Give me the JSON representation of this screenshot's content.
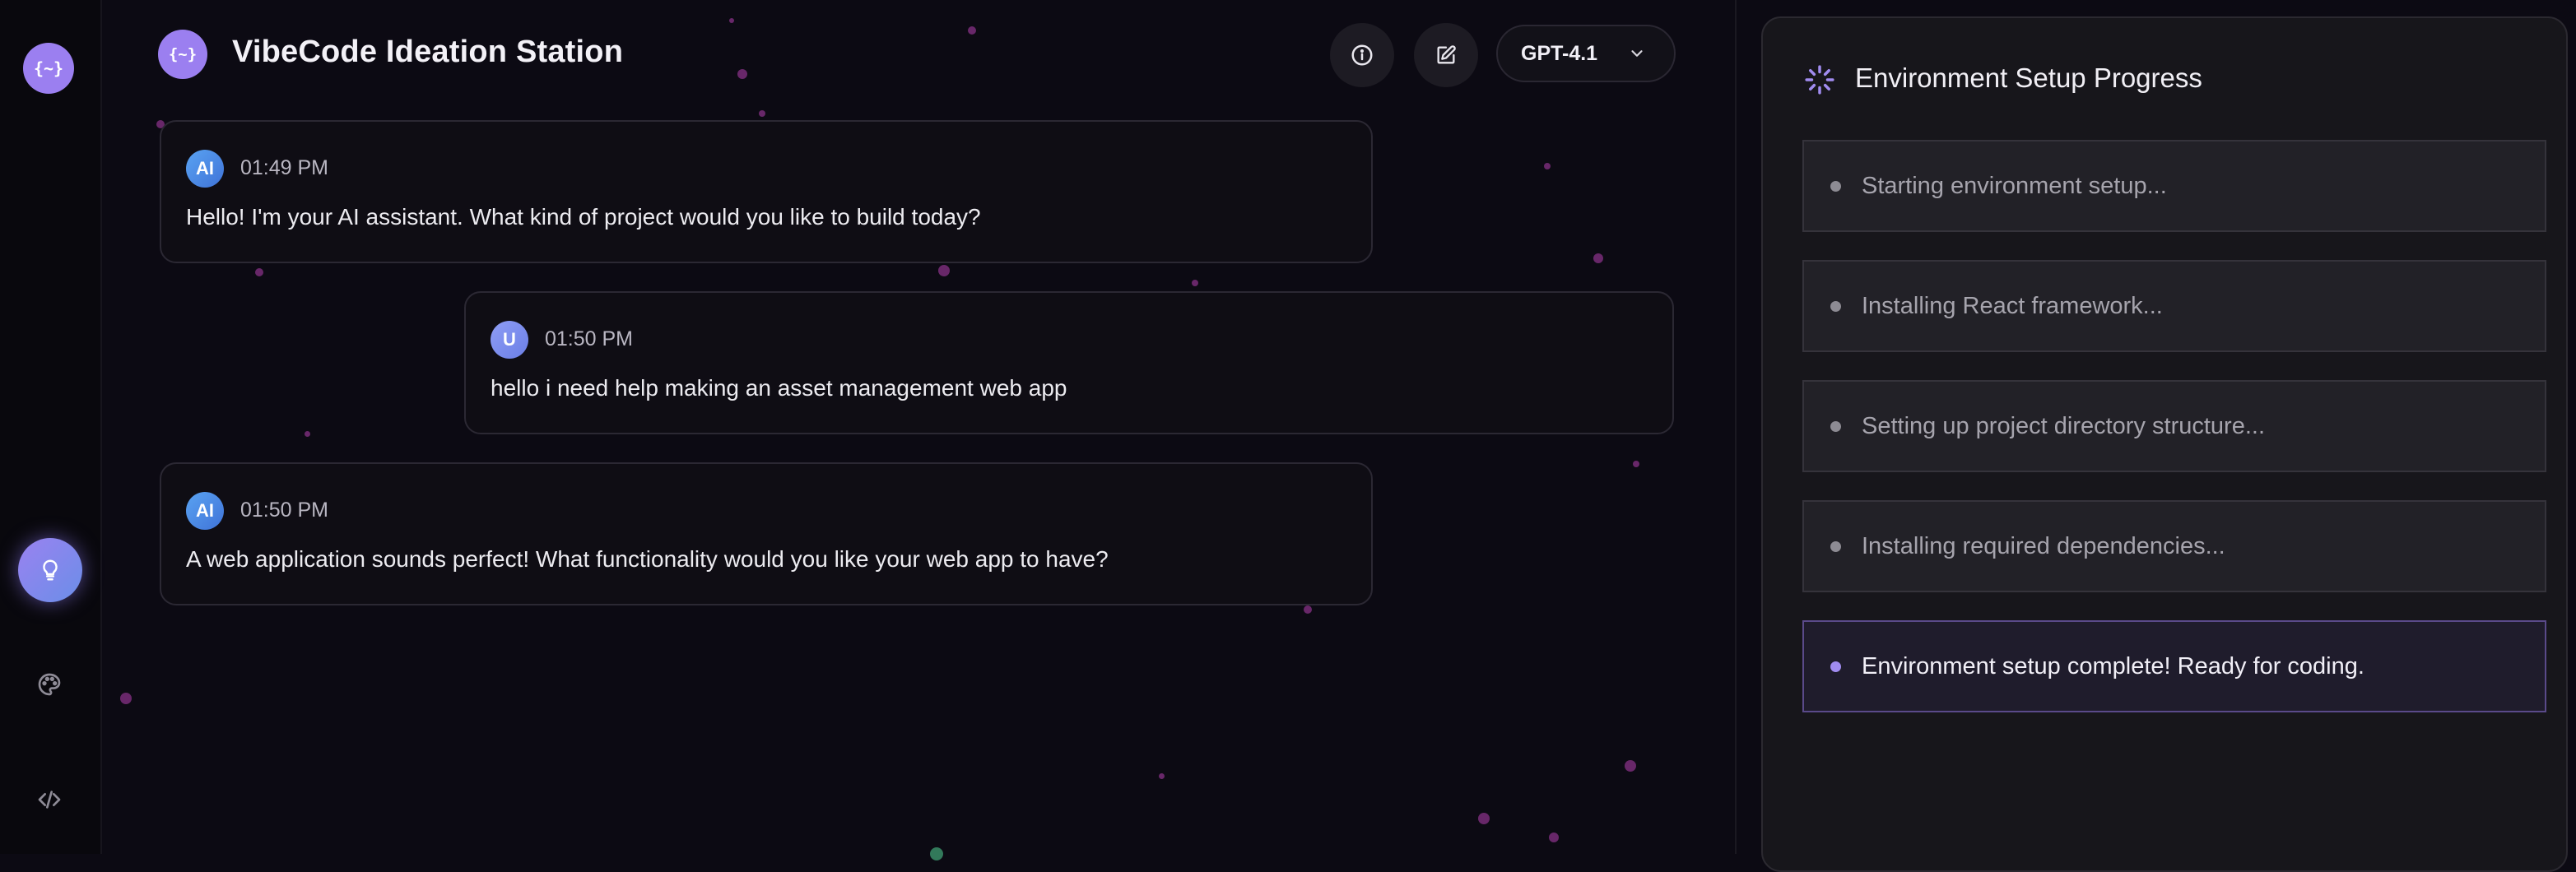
{
  "app": {
    "logo_text": "{~}",
    "title": "VibeCode Ideation Station"
  },
  "header": {
    "model_selected": "GPT-4.1"
  },
  "messages": [
    {
      "author": "ai",
      "avatar": "AI",
      "time": "01:49 PM",
      "text": "Hello! I'm your AI assistant. What kind of project would you like to build today?"
    },
    {
      "author": "user",
      "avatar": "U",
      "time": "01:50 PM",
      "text": "hello i need help making an asset management web app"
    },
    {
      "author": "ai",
      "avatar": "AI",
      "time": "01:50 PM",
      "text": "A web application sounds perfect! What functionality would you like your web app to have?"
    }
  ],
  "sidebar": {
    "icons": [
      "logo",
      "lightbulb-icon",
      "palette-icon",
      "code-icon"
    ]
  },
  "setup_panel": {
    "title": "Environment Setup Progress",
    "steps": [
      {
        "label": "Starting environment setup...",
        "status": "pending"
      },
      {
        "label": "Installing React framework...",
        "status": "pending"
      },
      {
        "label": "Setting up project directory structure...",
        "status": "pending"
      },
      {
        "label": "Installing required dependencies...",
        "status": "pending"
      },
      {
        "label": "Environment setup complete! Ready for coding.",
        "status": "complete"
      }
    ]
  },
  "colors": {
    "accent": "#9b7ff0",
    "background": "#0c0a13",
    "panel": "#17161b"
  }
}
